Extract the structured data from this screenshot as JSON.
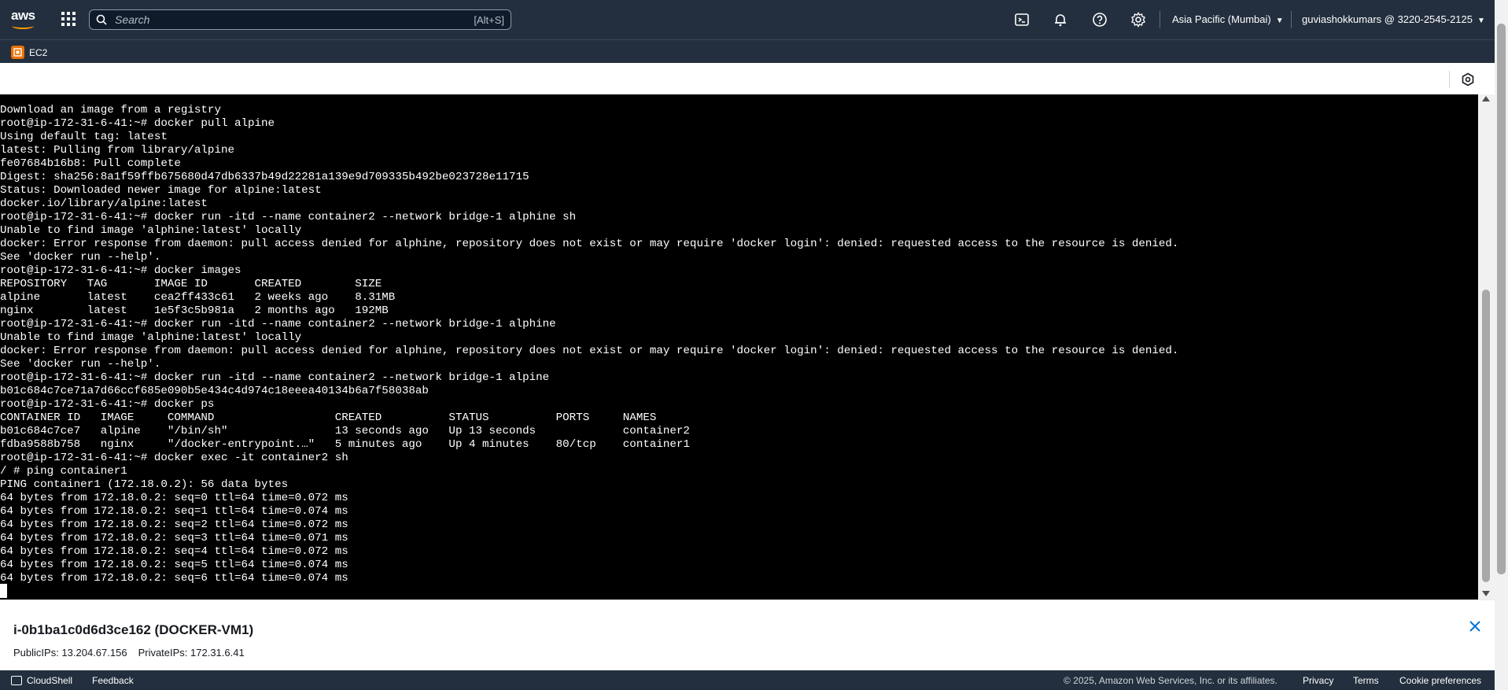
{
  "topnav": {
    "logo_text": "aws",
    "search_placeholder": "Search",
    "search_shortcut": "[Alt+S]",
    "region": "Asia Pacific (Mumbai)",
    "account": "guviashokkumars @ 3220-2545-2125"
  },
  "servicebar": {
    "service": "EC2"
  },
  "terminal": {
    "lines": [
      "Download an image from a registry",
      "root@ip-172-31-6-41:~# docker pull alpine",
      "Using default tag: latest",
      "latest: Pulling from library/alpine",
      "fe07684b16b8: Pull complete",
      "Digest: sha256:8a1f59ffb675680d47db6337b49d22281a139e9d709335b492be023728e11715",
      "Status: Downloaded newer image for alpine:latest",
      "docker.io/library/alpine:latest",
      "root@ip-172-31-6-41:~# docker run -itd --name container2 --network bridge-1 alphine sh",
      "Unable to find image 'alphine:latest' locally",
      "docker: Error response from daemon: pull access denied for alphine, repository does not exist or may require 'docker login': denied: requested access to the resource is denied.",
      "See 'docker run --help'.",
      "root@ip-172-31-6-41:~# docker images",
      "REPOSITORY   TAG       IMAGE ID       CREATED        SIZE",
      "alpine       latest    cea2ff433c61   2 weeks ago    8.31MB",
      "nginx        latest    1e5f3c5b981a   2 months ago   192MB",
      "root@ip-172-31-6-41:~# docker run -itd --name container2 --network bridge-1 alphine",
      "Unable to find image 'alphine:latest' locally",
      "docker: Error response from daemon: pull access denied for alphine, repository does not exist or may require 'docker login': denied: requested access to the resource is denied.",
      "See 'docker run --help'.",
      "root@ip-172-31-6-41:~# docker run -itd --name container2 --network bridge-1 alpine",
      "b01c684c7ce71a7d66ccf685e090b5e434c4d974c18eeea40134b6a7f58038ab",
      "root@ip-172-31-6-41:~# docker ps",
      "CONTAINER ID   IMAGE     COMMAND                  CREATED          STATUS          PORTS     NAMES",
      "b01c684c7ce7   alpine    \"/bin/sh\"                13 seconds ago   Up 13 seconds             container2",
      "fdba9588b758   nginx     \"/docker-entrypoint.…\"   5 minutes ago    Up 4 minutes    80/tcp    container1",
      "root@ip-172-31-6-41:~# docker exec -it container2 sh",
      "/ # ping container1",
      "PING container1 (172.18.0.2): 56 data bytes",
      "64 bytes from 172.18.0.2: seq=0 ttl=64 time=0.072 ms",
      "64 bytes from 172.18.0.2: seq=1 ttl=64 time=0.074 ms",
      "64 bytes from 172.18.0.2: seq=2 ttl=64 time=0.072 ms",
      "64 bytes from 172.18.0.2: seq=3 ttl=64 time=0.071 ms",
      "64 bytes from 172.18.0.2: seq=4 ttl=64 time=0.072 ms",
      "64 bytes from 172.18.0.2: seq=5 ttl=64 time=0.074 ms",
      "64 bytes from 172.18.0.2: seq=6 ttl=64 time=0.074 ms"
    ]
  },
  "instance": {
    "title": "i-0b1ba1c0d6d3ce162 (DOCKER-VM1)",
    "public_ips": "PublicIPs: 13.204.67.156",
    "private_ips": "PrivateIPs: 172.31.6.41"
  },
  "footer": {
    "cloudshell": "CloudShell",
    "feedback": "Feedback",
    "copyright": "© 2025, Amazon Web Services, Inc. or its affiliates.",
    "privacy": "Privacy",
    "terms": "Terms",
    "cookie": "Cookie preferences"
  },
  "colors": {
    "nav_bg": "#232f3e",
    "accent": "#ff9900",
    "ec2": "#ed7100",
    "terminal_bg": "#000000",
    "terminal_fg": "#ffffff",
    "link_blue": "#0972d3"
  },
  "icons": [
    "aws-logo",
    "services-grid-icon",
    "search-icon",
    "cloudshell-icon",
    "bell-icon",
    "help-icon",
    "gear-icon",
    "ec2-icon",
    "session-settings-icon",
    "close-icon"
  ]
}
